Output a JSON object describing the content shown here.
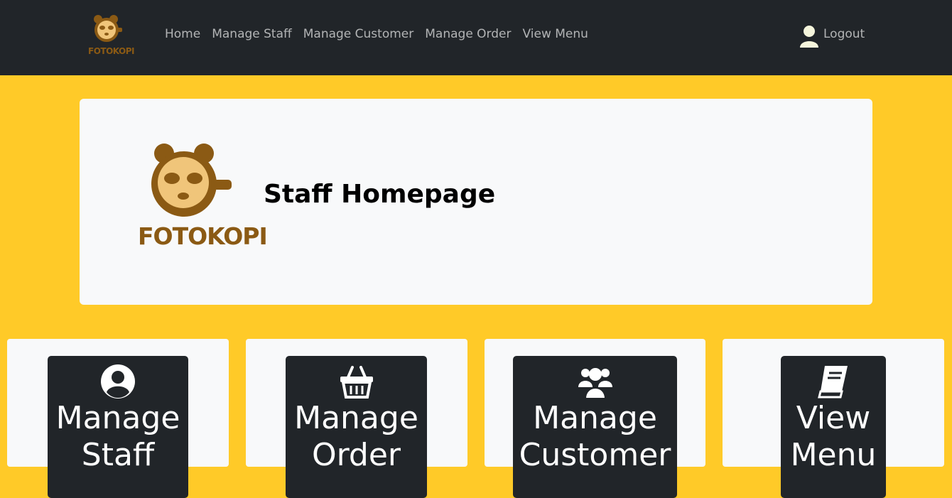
{
  "brand": {
    "name": "FOTOKOPI",
    "color": "#8b5a14"
  },
  "nav": {
    "links": [
      "Home",
      "Manage Staff",
      "Manage Customer",
      "Manage Order",
      "View Menu"
    ],
    "logout": "Logout"
  },
  "hero": {
    "title": "Staff Homepage"
  },
  "cards": [
    {
      "label": "Manage Staff",
      "icon": "user-circle-icon"
    },
    {
      "label": "Manage Order",
      "icon": "shopping-basket-icon"
    },
    {
      "label": "Manage Customer",
      "icon": "users-icon"
    },
    {
      "label": "View Menu",
      "icon": "book-icon"
    }
  ],
  "colors": {
    "navbar": "#212529",
    "background": "#ffca28",
    "panel": "#f8f9fa"
  }
}
